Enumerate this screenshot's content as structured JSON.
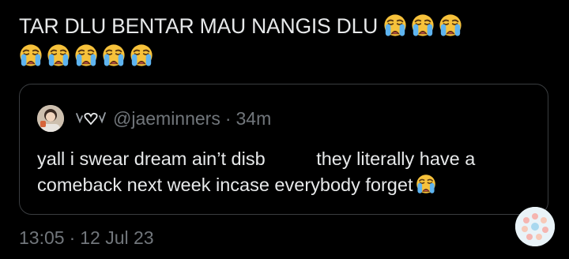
{
  "tweet": {
    "text": "TAR DLU BENTAR MAU NANGIS DLU",
    "emoji": "loudly-crying-face-icon",
    "emoji_count": 8,
    "timestamp_time": "13:05",
    "timestamp_date": "12 Jul 23"
  },
  "quote": {
    "display_name_icons": "hearts-display-name-icon",
    "handle": "@jaeminners",
    "separator": "·",
    "time": "34m",
    "text_part1": "yall i swear dream ain’t disb",
    "text_part2": "they literally have a comeback next week incase everybody forget"
  },
  "separator": "·",
  "colors": {
    "background": "#000000",
    "text": "#e7e9ea",
    "muted": "#71767b",
    "border": "#3a3d40",
    "emoji_yellow": "#f7c23b",
    "emoji_tears": "#5eb4f0"
  }
}
